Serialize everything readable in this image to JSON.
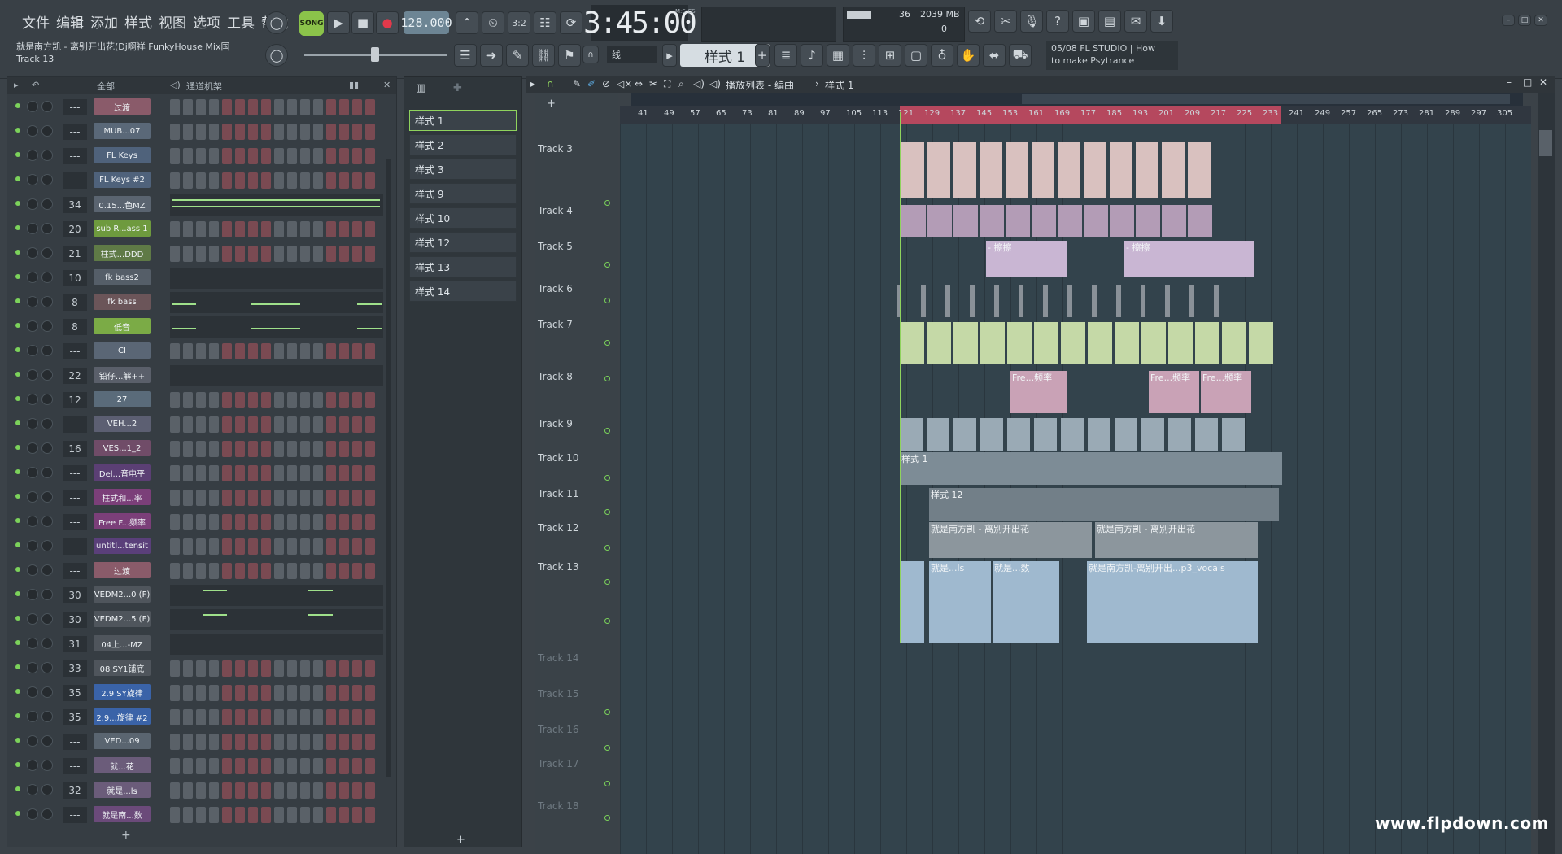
{
  "menu": [
    "文件",
    "编辑",
    "添加",
    "样式",
    "视图",
    "选项",
    "工具",
    "帮助"
  ],
  "transport": {
    "mode": "SONG",
    "tempo": "128.000",
    "time": "3:45:00",
    "time_unit": "M:S:CS"
  },
  "cpu": {
    "voices": "36",
    "memory": "2039 MB",
    "value": "0"
  },
  "hint": {
    "line1": "就是南方凯 - 离别开出花(Dj啊祥 FunkyHouse Mix国",
    "line2": "Track 13"
  },
  "snap": "线",
  "current_pattern": "样式 1",
  "news": {
    "line1": "05/08  FL STUDIO | How",
    "line2": "to make Psytrance"
  },
  "rack": {
    "filter": "全部",
    "title": "通道机架",
    "channels": [
      {
        "num": "---",
        "name": "过渡",
        "color": "#8a5b6a",
        "kind": "steps"
      },
      {
        "num": "---",
        "name": "MUB...07",
        "color": "#5a6878",
        "kind": "steps"
      },
      {
        "num": "---",
        "name": "FL Keys",
        "color": "#4f627b",
        "kind": "steps"
      },
      {
        "num": "---",
        "name": "FL Keys #2",
        "color": "#4f627b",
        "kind": "steps"
      },
      {
        "num": "34",
        "name": "0.15...色MZ",
        "color": "#5a6470",
        "kind": "graph"
      },
      {
        "num": "20",
        "name": "sub R...ass 1",
        "color": "#6e9a3e",
        "kind": "steps"
      },
      {
        "num": "21",
        "name": "柱式...DDD",
        "color": "#5f7a46",
        "kind": "steps"
      },
      {
        "num": "10",
        "name": "fk bass2",
        "color": "#555e68",
        "kind": "graph"
      },
      {
        "num": "8",
        "name": "fk bass",
        "color": "#6b5559",
        "kind": "graph"
      },
      {
        "num": "8",
        "name": "低音",
        "color": "#7bab46",
        "kind": "graph"
      },
      {
        "num": "---",
        "name": "CI",
        "color": "#5a6675",
        "kind": "steps"
      },
      {
        "num": "22",
        "name": "铅仔...解++",
        "color": "#5a5f6a",
        "kind": "graph"
      },
      {
        "num": "12",
        "name": "27",
        "color": "#5a6b7a",
        "kind": "steps"
      },
      {
        "num": "---",
        "name": "VEH...2",
        "color": "#5c5f72",
        "kind": "steps"
      },
      {
        "num": "16",
        "name": "VES...1_2",
        "color": "#704c68",
        "kind": "steps"
      },
      {
        "num": "---",
        "name": "Del...音电平",
        "color": "#5b3f74",
        "kind": "steps"
      },
      {
        "num": "---",
        "name": "柱式和...率",
        "color": "#7b3f79",
        "kind": "steps"
      },
      {
        "num": "---",
        "name": "Free F...频率",
        "color": "#7b3f79",
        "kind": "steps"
      },
      {
        "num": "---",
        "name": "untitl...tensit",
        "color": "#5a3f7a",
        "kind": "steps"
      },
      {
        "num": "---",
        "name": "过渡",
        "color": "#8a5b6a",
        "kind": "steps"
      },
      {
        "num": "30",
        "name": "VEDM2...0 (F)",
        "color": "#4f555c",
        "kind": "graph"
      },
      {
        "num": "30",
        "name": "VEDM2...5 (F)",
        "color": "#4f555c",
        "kind": "graph"
      },
      {
        "num": "31",
        "name": "04上...-MZ",
        "color": "#4f555c",
        "kind": "graph"
      },
      {
        "num": "33",
        "name": "08 SY1铺底",
        "color": "#4f555c",
        "kind": "steps"
      },
      {
        "num": "35",
        "name": "2.9 SY旋律",
        "color": "#3a63a8",
        "kind": "steps"
      },
      {
        "num": "35",
        "name": "2.9...旋律 #2",
        "color": "#3a63a8",
        "kind": "steps"
      },
      {
        "num": "---",
        "name": "VED...09",
        "color": "#5a6570",
        "kind": "steps"
      },
      {
        "num": "---",
        "name": "就...花",
        "color": "#6b5c7a",
        "kind": "steps"
      },
      {
        "num": "32",
        "name": "就是...ls",
        "color": "#6b5c7a",
        "kind": "steps"
      },
      {
        "num": "---",
        "name": "就是南...数",
        "color": "#6b4a7a",
        "kind": "steps"
      }
    ]
  },
  "picker": {
    "patterns": [
      "样式 1",
      "样式 2",
      "样式 3",
      "样式 9",
      "样式 10",
      "样式 12",
      "样式 13",
      "样式 14"
    ]
  },
  "playlist": {
    "title": "播放列表 - 编曲",
    "breadcrumb": "样式 1",
    "ruler": [
      "41",
      "49",
      "57",
      "65",
      "73",
      "81",
      "89",
      "97",
      "105",
      "113",
      "121",
      "129",
      "137",
      "145",
      "153",
      "161",
      "169",
      "177",
      "185",
      "193",
      "201",
      "209",
      "217",
      "225",
      "233",
      "241",
      "249",
      "257",
      "265",
      "273",
      "281",
      "289",
      "297",
      "305"
    ],
    "tracks": [
      "Track 3",
      "Track 4",
      "Track 5",
      "Track 6",
      "Track 7",
      "Track 8",
      "Track 9",
      "Track 10",
      "Track 11",
      "Track 12",
      "Track 13",
      "Track 14",
      "Track 15",
      "Track 16",
      "Track 17",
      "Track 18"
    ],
    "clip_labels": {
      "t5a": "- 擦擦",
      "t5b": "- 擦擦",
      "t8a": "Fre...频率",
      "t8b": "Fre...频率",
      "t8c": "Fre...频率",
      "t10a": "样",
      "t10b": "样式 1",
      "t11a": "样式 12",
      "t12a": "就是南方凯 - 离别开出花",
      "t12b": "就是南方凯 - 离别开出花",
      "t13a": "就是...ls",
      "t13b": "就是...数",
      "t13c": "就是南方凯-离别开出...p3_vocals"
    }
  },
  "watermark": "www.flpdown.com",
  "colors": {
    "accent": "#8fd35d",
    "ruler_highlight": "#b5485e",
    "clip": "#9fb9cf"
  }
}
